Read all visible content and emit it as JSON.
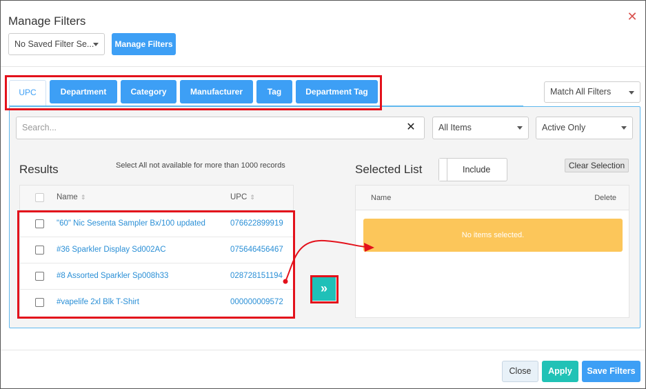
{
  "dialog": {
    "title": "Manage Filters",
    "close_glyph": "✕"
  },
  "top_bar": {
    "saved_filter_select": "No Saved Filter Se...",
    "manage_filters_button": "Manage Filters"
  },
  "tabs": [
    {
      "label": "UPC",
      "active": true
    },
    {
      "label": "Department",
      "active": false
    },
    {
      "label": "Category",
      "active": false
    },
    {
      "label": "Manufacturer",
      "active": false
    },
    {
      "label": "Tag",
      "active": false
    },
    {
      "label": "Department Tag",
      "active": false
    }
  ],
  "match_select": "Match All Filters",
  "search": {
    "placeholder": "Search...",
    "clear_glyph": "✕"
  },
  "filters": {
    "items_select": "All Items",
    "status_select": "Active Only"
  },
  "results": {
    "title": "Results",
    "note": "Select All not available for more than 1000 records",
    "columns": {
      "name": "Name",
      "upc": "UPC"
    },
    "sort_glyph": "⇕",
    "rows": [
      {
        "name": "\"60\" Nic Sesenta Sampler Bx/100 updated",
        "upc": "076622899919"
      },
      {
        "name": "#36 Sparkler Display Sd002AC",
        "upc": "075646456467"
      },
      {
        "name": "#8 Assorted Sparkler Sp008h33",
        "upc": "028728151194"
      },
      {
        "name": "#vapelife 2xl Blk T-Shirt",
        "upc": "000000009572"
      }
    ]
  },
  "move_button_glyph": "»",
  "selected": {
    "title": "Selected List",
    "include_label": "Include",
    "clear_button": "Clear Selection",
    "columns": {
      "name": "Name",
      "delete": "Delete"
    },
    "empty_message": "No items selected."
  },
  "footer": {
    "close": "Close",
    "apply": "Apply",
    "save": "Save Filters"
  },
  "colors": {
    "primary": "#3d9ff5",
    "teal": "#21c2b6",
    "warning": "#fcc65a",
    "annotation_red": "#e3111b",
    "close_red": "#d9534f"
  }
}
